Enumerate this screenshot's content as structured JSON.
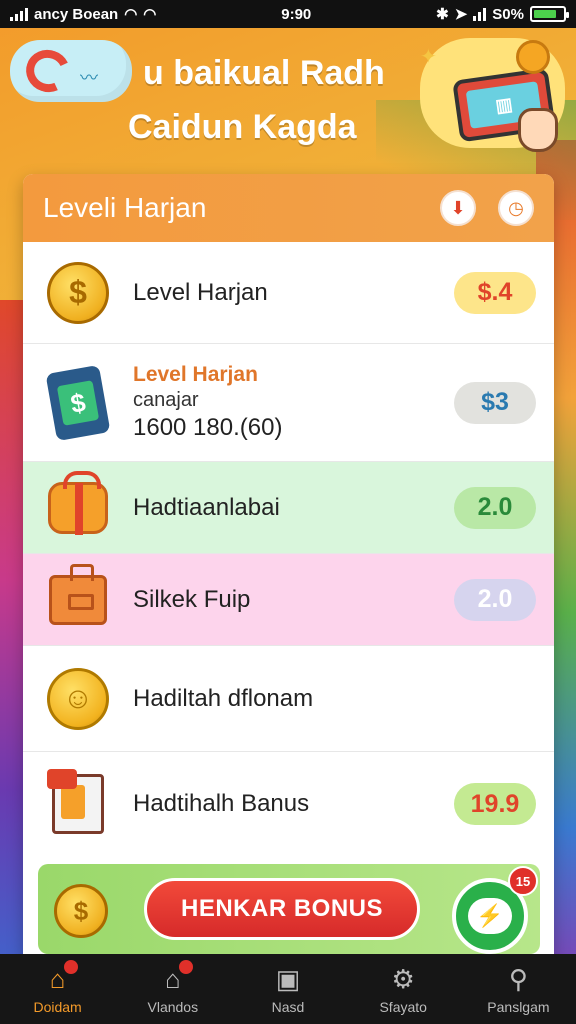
{
  "status_bar": {
    "carrier": "ancy Boean",
    "time": "9:90",
    "battery": "S0%"
  },
  "header": {
    "title_line1": "u baikual Radh",
    "title_line2": "Caidun Kagda"
  },
  "card": {
    "title": "Leveli Harjan",
    "rows": [
      {
        "label": "Level Harjan",
        "value": "$.4",
        "pill_bg": "#fde58a",
        "pill_color": "#e0442a"
      },
      {
        "title": "Level Harjan",
        "sub": "canajar",
        "detail": "1600 180.(60)",
        "value": "$3",
        "pill_bg": "#e2e2de",
        "pill_color": "#2a7ab0"
      },
      {
        "label": "Hadtiaanlabai",
        "value": "2.0",
        "pill_bg": "#b9e8a6",
        "pill_color": "#2a8a3a"
      },
      {
        "label": "Silkek Fuip",
        "value": "2.0",
        "pill_bg": "#d6d4ee",
        "pill_color": "#ffffff"
      },
      {
        "label": "Hadiltah dflonam"
      },
      {
        "label": "Hadtihalh Banus",
        "value": "19.9",
        "pill_bg": "#c4ea92",
        "pill_color": "#e0442a"
      }
    ]
  },
  "bonus": {
    "button_label": "HENKAR BONUS",
    "badge": "15"
  },
  "nav": {
    "items": [
      {
        "label": "Doidam",
        "icon": "home-icon"
      },
      {
        "label": "Vlandos",
        "icon": "store-icon"
      },
      {
        "label": "Nasd",
        "icon": "frame-icon"
      },
      {
        "label": "Sfayato",
        "icon": "gear-icon"
      },
      {
        "label": "Panslgam",
        "icon": "search-icon"
      }
    ]
  }
}
